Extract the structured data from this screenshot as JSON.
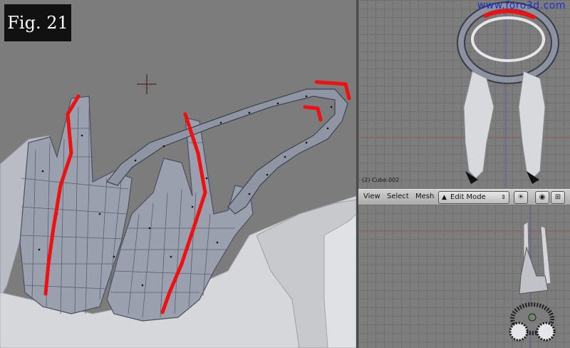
{
  "figure": {
    "label": "Fig. 21"
  },
  "watermark": {
    "text": "www.foro3d.com"
  },
  "top_view": {
    "object_label": "(2) Cube.002"
  },
  "header": {
    "menu": [
      "View",
      "Select",
      "Mesh"
    ],
    "mode": "Edit Mode",
    "icons": [
      "edit-mode-icon",
      "chevron-updown-icon",
      "pivot-icon",
      "view-icon",
      "snap-icon"
    ]
  },
  "colors": {
    "mesh": "#9aa0ad",
    "mesh_dark": "#5b6070",
    "highlight": "#ee1111",
    "background": "#7b7b7b",
    "watermark": "#1a2fd0"
  }
}
